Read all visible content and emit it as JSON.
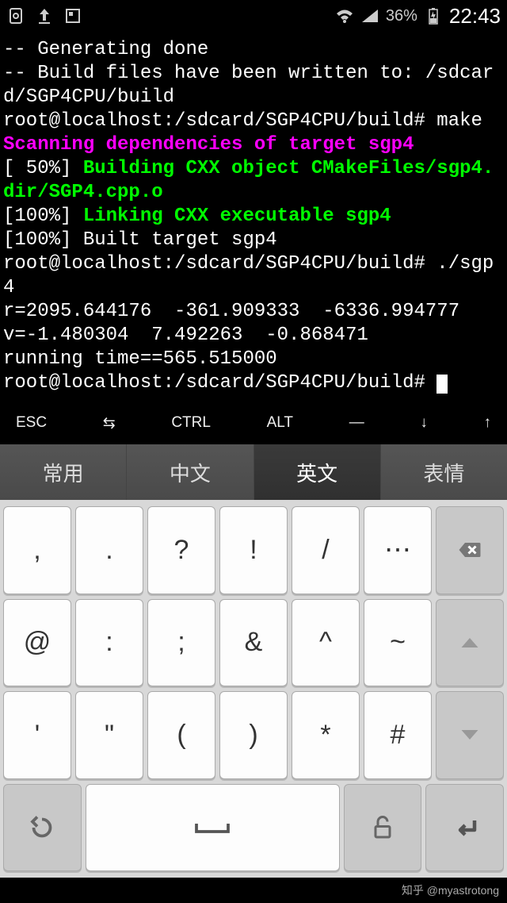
{
  "status": {
    "battery_pct": "36%",
    "time": "22:43"
  },
  "terminal": {
    "lines": [
      {
        "c": "white",
        "t": "-- Generating done"
      },
      {
        "c": "white",
        "t": "-- Build files have been written to: /sdcard/SGP4CPU/build"
      },
      {
        "c": "white",
        "t": "root@localhost:/sdcard/SGP4CPU/build# make"
      },
      {
        "c": "magenta",
        "t": "Scanning dependencies of target sgp4"
      },
      {
        "c": "mixed",
        "pre": "[ 50%] ",
        "body": "Building CXX object CMakeFiles/sgp4.dir/SGP4.cpp.o"
      },
      {
        "c": "mixed",
        "pre": "[100%] ",
        "body": "Linking CXX executable sgp4"
      },
      {
        "c": "white",
        "t": "[100%] Built target sgp4"
      },
      {
        "c": "white",
        "t": "root@localhost:/sdcard/SGP4CPU/build# ./sgp4"
      },
      {
        "c": "white",
        "t": "r=2095.644176  -361.909333  -6336.994777"
      },
      {
        "c": "white",
        "t": "v=-1.480304  7.492263  -0.868471"
      },
      {
        "c": "white",
        "t": "running time==565.515000"
      },
      {
        "c": "prompt",
        "t": "root@localhost:/sdcard/SGP4CPU/build# "
      }
    ]
  },
  "fn": {
    "esc": "ESC",
    "tab": "⇆",
    "ctrl": "CTRL",
    "alt": "ALT",
    "dash": "—",
    "down": "↓",
    "up": "↑"
  },
  "ime": {
    "tabs": [
      "常用",
      "中文",
      "英文",
      "表情"
    ],
    "active": 2
  },
  "keys": {
    "r1": [
      ",",
      ".",
      "?",
      "!",
      "/",
      "⋯"
    ],
    "r2": [
      "@",
      ":",
      ";",
      "&",
      "^",
      "~"
    ],
    "r3": [
      "'",
      "\"",
      "(",
      ")",
      "*",
      "#"
    ]
  },
  "watermark": "知乎 @myastrotong"
}
